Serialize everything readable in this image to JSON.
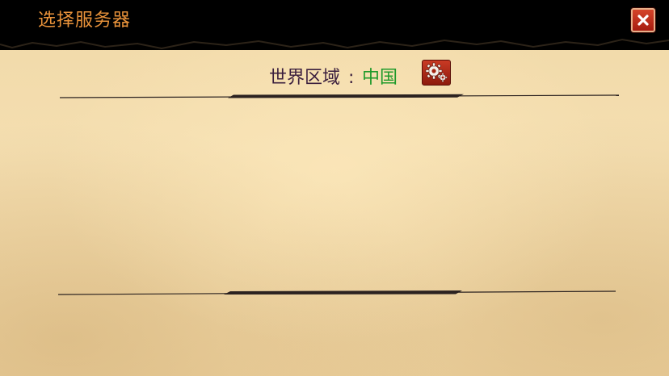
{
  "header": {
    "title": "选择服务器",
    "close_icon": "close-icon"
  },
  "region": {
    "label": "世界区域",
    "separator": ":",
    "value": "中国",
    "settings_icon": "gear-icon"
  },
  "colors": {
    "title": "#e8923a",
    "region_label": "#3b1f3e",
    "region_value": "#1f9a2a",
    "close_button": "#c4311d",
    "parchment": "#f2dba9"
  }
}
